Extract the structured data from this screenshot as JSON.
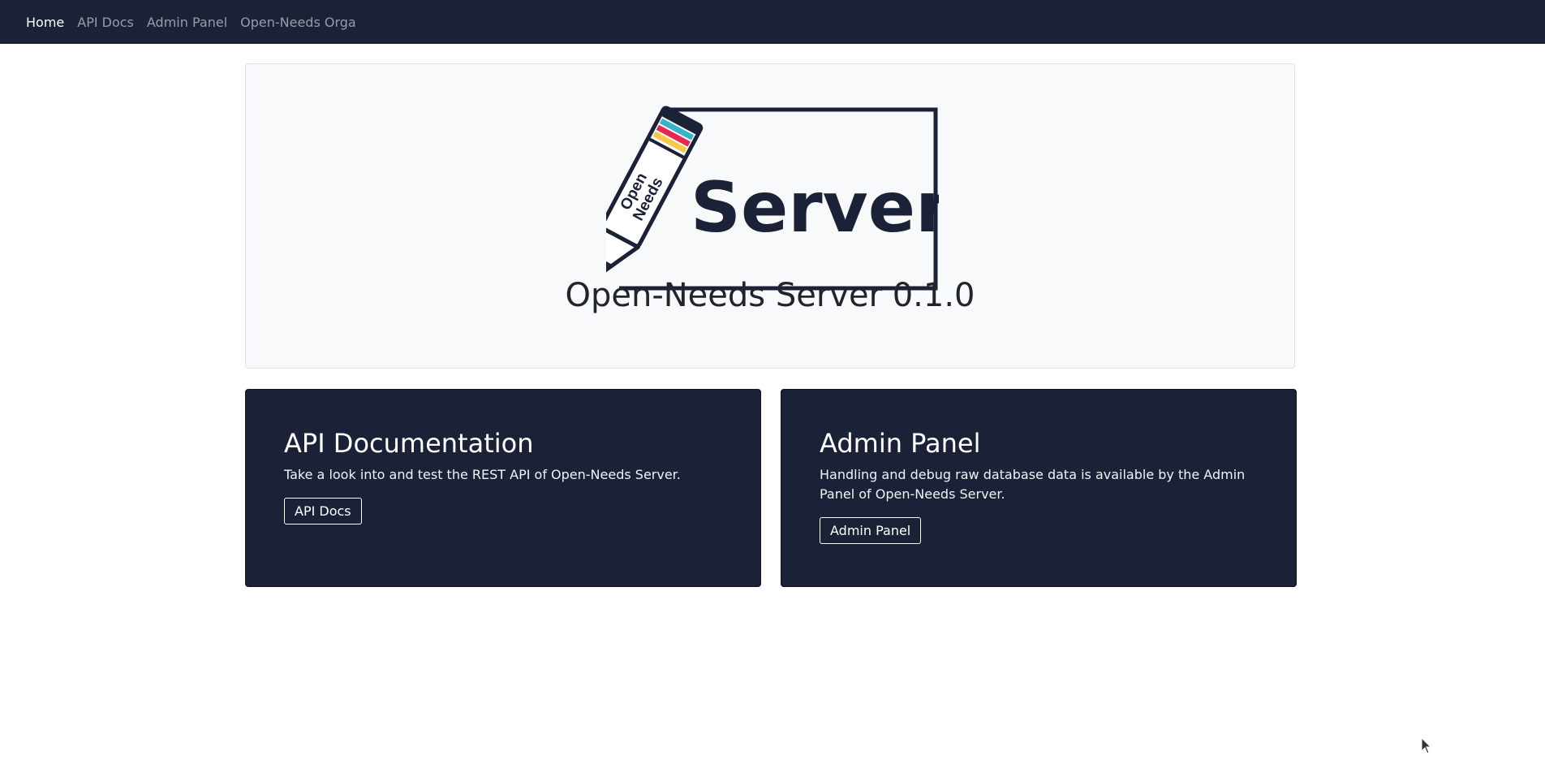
{
  "navbar": {
    "items": [
      {
        "label": "Home"
      },
      {
        "label": "API Docs"
      },
      {
        "label": "Admin Panel"
      },
      {
        "label": "Open-Needs Orga"
      }
    ]
  },
  "hero": {
    "logo_pencil_text": "Open Needs",
    "logo_word": "Server",
    "title": "Open-Needs Server 0.1.0"
  },
  "cards": [
    {
      "title": "API Documentation",
      "text": "Take a look into and test the REST API of Open-Needs Server.",
      "button": "API Docs"
    },
    {
      "title": "Admin Panel",
      "text": "Handling and debug raw database data is available by the Admin Panel of Open-Needs Server.",
      "button": "Admin Panel"
    }
  ],
  "colors": {
    "navy": "#1b2136",
    "stripe_cyan": "#35b3c9",
    "stripe_red": "#e8264f",
    "stripe_yellow": "#f7c948"
  }
}
